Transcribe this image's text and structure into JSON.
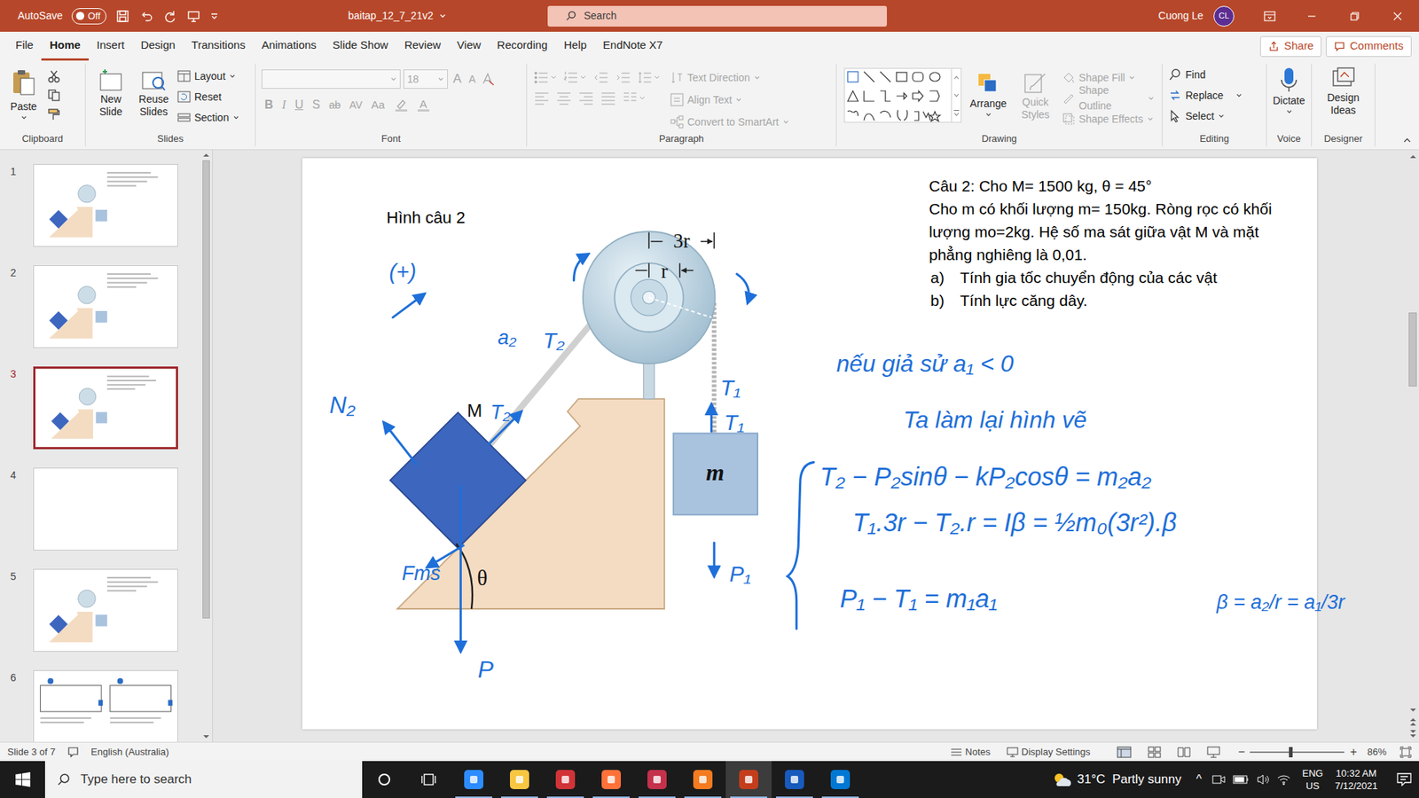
{
  "window": {
    "autosave": "AutoSave",
    "autosave_state": "Off",
    "autosave_on": false,
    "title": "baitap_12_7_21v2",
    "search": "Search",
    "user": "Cuong Le",
    "initials": "CL"
  },
  "menu": {
    "tabs": [
      {
        "label": "File",
        "selected": false
      },
      {
        "label": "Home",
        "selected": true
      },
      {
        "label": "Insert",
        "selected": false
      },
      {
        "label": "Design",
        "selected": false
      },
      {
        "label": "Transitions",
        "selected": false
      },
      {
        "label": "Animations",
        "selected": false
      },
      {
        "label": "Slide Show",
        "selected": false
      },
      {
        "label": "Review",
        "selected": false
      },
      {
        "label": "View",
        "selected": false
      },
      {
        "label": "Recording",
        "selected": false
      },
      {
        "label": "Help",
        "selected": false
      },
      {
        "label": "EndNote X7",
        "selected": false
      }
    ],
    "share": "Share",
    "comments": "Comments"
  },
  "ribbon": {
    "clipboard": {
      "label": "Clipboard",
      "paste": "Paste"
    },
    "slides": {
      "label": "Slides",
      "new_slide": "New Slide",
      "reuse": "Reuse Slides",
      "layout": "Layout",
      "reset": "Reset",
      "section": "Section"
    },
    "font": {
      "label": "Font",
      "disabled": true,
      "size": "18",
      "grow": "A",
      "shrink": "A",
      "bold": "B",
      "italic": "I",
      "underline": "U",
      "shadow": "S",
      "strike": "ab",
      "spacing": "AV",
      "case": "Aa",
      "color": "A"
    },
    "paragraph": {
      "label": "Paragraph",
      "disabled": true,
      "text_direction": "Text Direction",
      "align_text": "Align Text",
      "smartart": "Convert to SmartArt"
    },
    "drawing": {
      "label": "Drawing",
      "arrange": "Arrange",
      "styles_disabled": true,
      "quick_styles": "Quick Styles",
      "shape_fill": "Shape Fill",
      "shape_outline": "Shape Outline",
      "shape_effects": "Shape Effects"
    },
    "editing": {
      "label": "Editing",
      "find": "Find",
      "replace": "Replace",
      "select": "Select"
    },
    "voice": {
      "label": "Voice",
      "dictate": "Dictate"
    },
    "designer": {
      "label": "Designer",
      "design_ideas": "Design Ideas"
    }
  },
  "thumbnails": [
    {
      "number": "1",
      "kind": "diagram",
      "selected": false
    },
    {
      "number": "2",
      "kind": "diagram",
      "selected": false
    },
    {
      "number": "3",
      "kind": "diagram",
      "selected": true
    },
    {
      "number": "4",
      "kind": "blank",
      "selected": false
    },
    {
      "number": "5",
      "kind": "diagram",
      "selected": false
    },
    {
      "number": "6",
      "kind": "panels",
      "selected": false
    }
  ],
  "slide": {
    "caption": "Hình câu 2",
    "question": {
      "title": "Câu 2: Cho M= 1500 kg, θ = 45°",
      "lines": [
        "Cho m có khối lượng m= 150kg. Ròng rọc có khối",
        "lượng mo=2kg. Hệ số ma sát giữa vật M và mặt",
        "phẳng nghiêng là 0,01."
      ],
      "items": [
        {
          "marker": "a)",
          "text": "Tính gia tốc chuyển động của các vật"
        },
        {
          "marker": "b)",
          "text": "Tính lực căng dây."
        }
      ]
    },
    "diagram": {
      "big_mass": "M",
      "small_mass": "m",
      "angle": "θ",
      "outer": "3r",
      "inner": "r"
    },
    "annotations": [
      "(+)",
      "a₂",
      "T₂",
      "N₂",
      "T₂",
      "Fms",
      "P",
      "T₁",
      "T₁",
      "P₁",
      "nếu giả sử a₁ < 0",
      "Ta làm lại hình vẽ",
      "T₂ − P₂sinθ − kP₂cosθ = m₂a₂",
      "T₁.3r − T₂.r = Iβ = ½m₀(3r²).β",
      "P₁ − T₁ = m₁a₁",
      "β = a₂/r = a₁/3r"
    ]
  },
  "status_bar": {
    "slide_info": "Slide 3 of 7",
    "language": "English (Australia)",
    "notes": "Notes",
    "display_settings": "Display Settings",
    "zoom_out": "−",
    "zoom_in": "+",
    "zoom_level": 0.43,
    "zoom": "86%"
  },
  "taskbar": {
    "search": "Type here to search",
    "apps": [
      {
        "color": "#2d8cff",
        "running": true,
        "active": false
      },
      {
        "color": "#f8c640",
        "running": true,
        "active": false
      },
      {
        "color": "#d13438",
        "running": true,
        "active": false
      },
      {
        "color": "#ff7139",
        "running": true,
        "active": false
      },
      {
        "color": "#c4314b",
        "running": true,
        "active": false
      },
      {
        "color": "#f47b20",
        "running": true,
        "active": false
      },
      {
        "color": "#c43e1c",
        "running": true,
        "active": true
      },
      {
        "color": "#185abd",
        "running": true,
        "active": false
      },
      {
        "color": "#0078d4",
        "running": true,
        "active": false
      }
    ],
    "weather": "31°C  Partly sunny",
    "tray_caret": "^",
    "lang": "ENG",
    "region": "US",
    "time": "10:32 AM",
    "date": "7/12/2021"
  }
}
